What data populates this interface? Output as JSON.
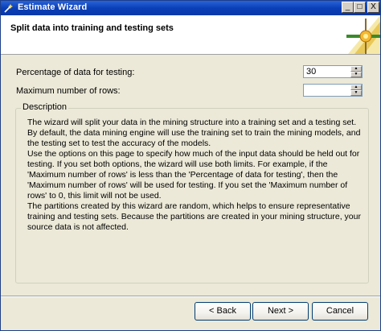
{
  "window": {
    "title": "Estimate Wizard",
    "minimize_glyph": "_",
    "maximize_glyph": "□",
    "close_glyph": "X"
  },
  "header": {
    "title": "Split data into training and testing sets",
    "graphic": "wizard-banner-icon"
  },
  "fields": {
    "percentage_label": "Percentage of data for testing:",
    "percentage_value": "30",
    "max_rows_label": "Maximum number of rows:",
    "max_rows_value": ""
  },
  "description": {
    "legend": "Description",
    "paragraphs": [
      "The wizard will split your data in the mining structure into a training set and a testing set. By default, the data mining engine will use the training set to train the mining models, and the testing set to test the accuracy of the models.",
      "Use the options on this page to specify how much of the input data should be held out for testing. If you set both options, the wizard will use both limits. For example, if the 'Maximum number of rows' is less than the 'Percentage of data for testing', then the 'Maximum number of rows' will be used for testing. If you set the 'Maximum number of rows' to 0, this limit will not be used.",
      "The partitions created by this wizard are random, which helps to ensure representative training and testing sets. Because the partitions are created in your mining structure, your source data is not affected."
    ]
  },
  "buttons": {
    "back": "< Back",
    "next": "Next >",
    "cancel": "Cancel"
  },
  "colors": {
    "titlebar": "#0a3fb8",
    "dialog_background": "#ece9d8",
    "button_border": "#003c74"
  }
}
